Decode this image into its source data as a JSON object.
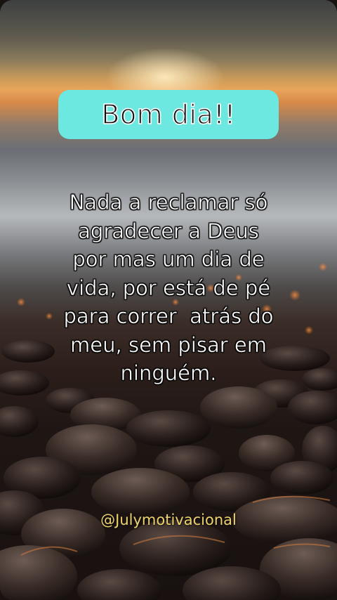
{
  "banner": {
    "title": "Bom dia!!"
  },
  "message": {
    "lines": [
      "Nada a reclamar só",
      "agradecer a Deus",
      "por mas um dia de",
      "vida, por está de pé",
      "para correr  atrás do",
      "meu, sem pisar em",
      "ninguém."
    ]
  },
  "footer": {
    "handle": "@Julymotivacional"
  },
  "colors": {
    "banner": "#6ce8e0",
    "handle": "#ecd26a",
    "message_text": "#ffffff"
  }
}
